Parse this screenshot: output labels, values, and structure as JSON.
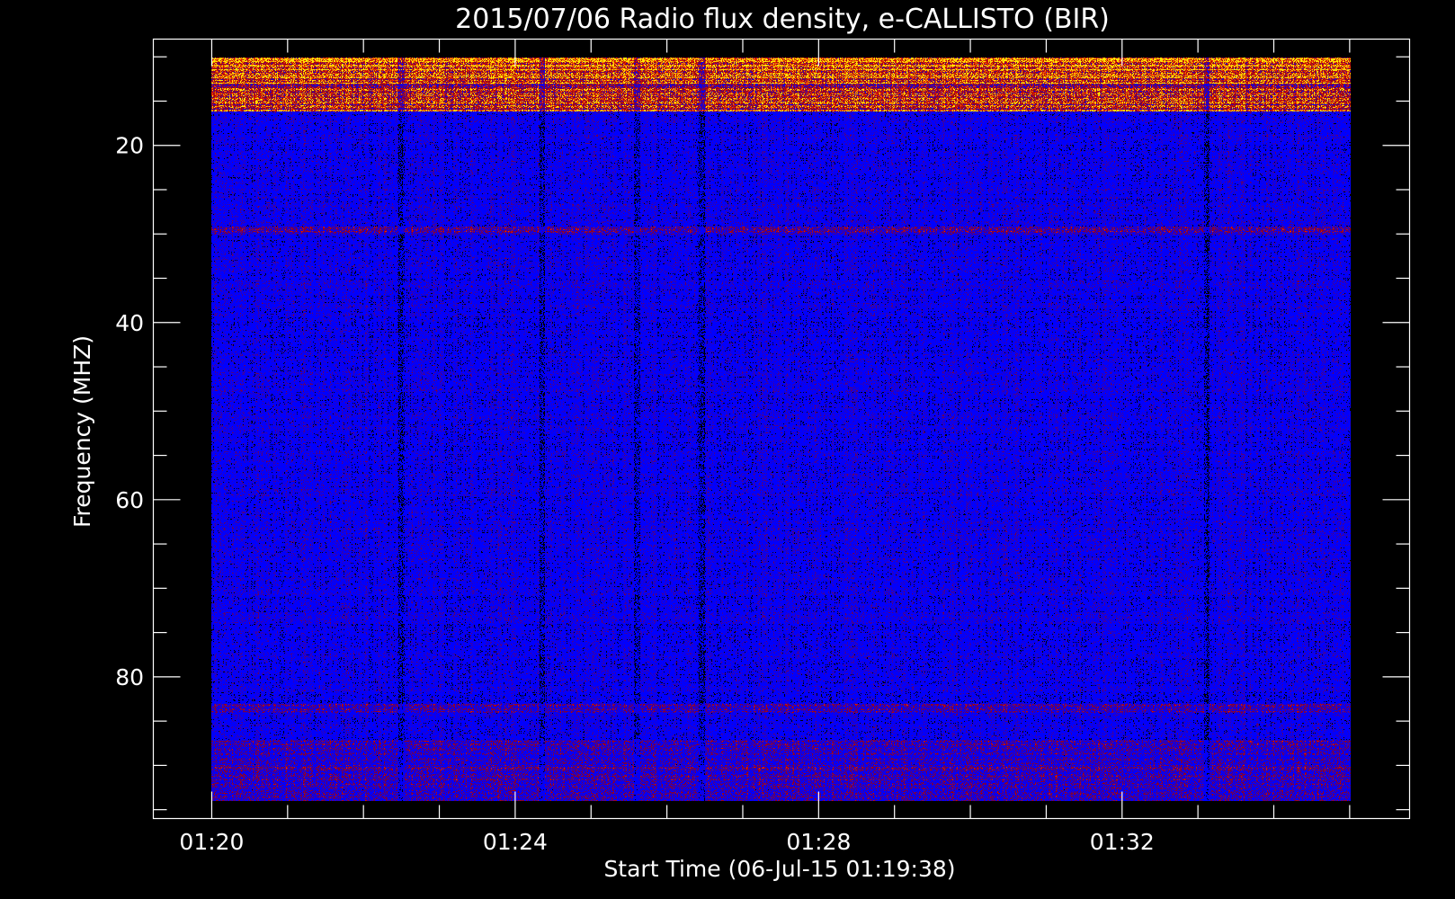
{
  "chart_data": {
    "type": "heatmap",
    "title": "2015/07/06  Radio flux density, e-CALLISTO (BIR)",
    "xlabel": "Start Time (06-Jul-15 01:19:38)",
    "ylabel": "Frequency (MHZ)",
    "x_axis": {
      "unit": "minutes after 01:20",
      "range": [
        -0.77,
        15.79
      ],
      "major_ticks": [
        0,
        4,
        8,
        12
      ],
      "tick_labels": [
        "01:20",
        "01:24",
        "01:28",
        "01:32"
      ],
      "minor_tick_step": 1
    },
    "y_axis": {
      "unit": "MHz",
      "range": [
        96,
        8
      ],
      "reversed": true,
      "major_ticks": [
        20,
        40,
        60,
        80
      ],
      "tick_labels": [
        "20",
        "40",
        "60",
        "80"
      ],
      "minor_tick_step": 5
    },
    "data_extent": {
      "time_minutes": [
        0,
        15
      ],
      "frequency_mhz": [
        10,
        94
      ]
    },
    "colormap": [
      "#000000",
      "#0000ff",
      "#960014",
      "#e61e00",
      "#ffe600"
    ],
    "bands": [
      {
        "freq_mhz": [
          10,
          13
        ],
        "level": 0.55
      },
      {
        "freq_mhz": [
          13,
          16
        ],
        "level": 0.45
      },
      {
        "freq_mhz": [
          29,
          30
        ],
        "level": 0.2
      },
      {
        "freq_mhz": [
          83,
          84
        ],
        "level": 0.2
      },
      {
        "freq_mhz": [
          87,
          94
        ],
        "level": 0.15
      }
    ],
    "dark_time_streaks_minutes": [
      2.5,
      4.35,
      5.6,
      6.45,
      13.1
    ],
    "background_level": 0.35
  }
}
